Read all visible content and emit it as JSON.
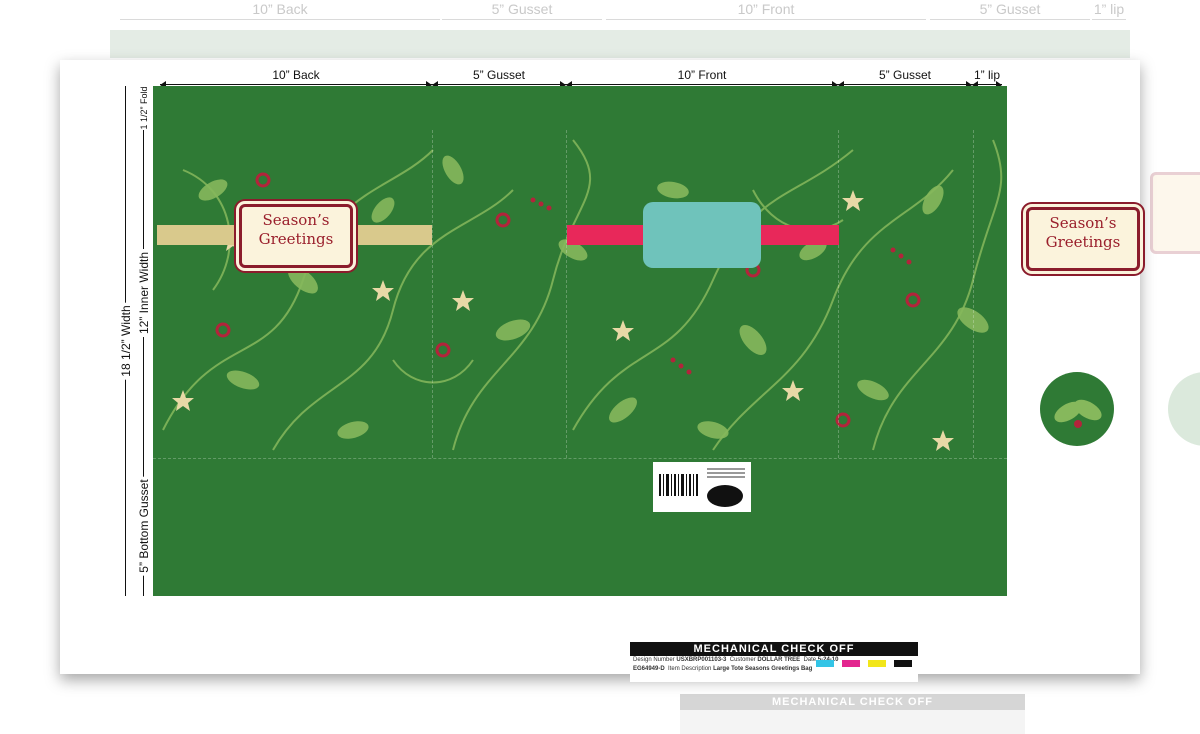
{
  "dimensions": {
    "back": "10” Back",
    "gusset1": "5” Gusset",
    "front": "10” Front",
    "gusset2": "5” Gusset",
    "lip": "1” lip",
    "fold": "1 1/2” Fold",
    "inner_width": "12” Inner Width",
    "total_width": "18 1/2” Width",
    "bottom_gusset": "5” Bottom Gusset"
  },
  "label": {
    "line1": "Season’s",
    "line2": "Greetings"
  },
  "checkoff": {
    "title": "MECHANICAL CHECK OFF",
    "design_number_label": "Design Number",
    "design_number": "USXBRP001103-3",
    "customer_label": "Customer",
    "customer": "DOLLAR TREE",
    "date_label": "Date",
    "date": "5-24-10",
    "sku": "EG64949-D",
    "item_description_label": "Item Description",
    "item_description": "Large Tote Seasons Greetings Bag"
  },
  "colors": {
    "bag_green": "#2f7a35",
    "leaf_light": "#86b85c",
    "label_red": "#8b1c2c",
    "label_cream": "#fbf3dc",
    "ribbon_pink": "#e8285a",
    "tag_teal": "#6fc3bb",
    "ribbon_gold": "#d9c98c",
    "swatches": [
      "#33c4e6",
      "#e3268f",
      "#f2e61a",
      "#111111"
    ]
  }
}
